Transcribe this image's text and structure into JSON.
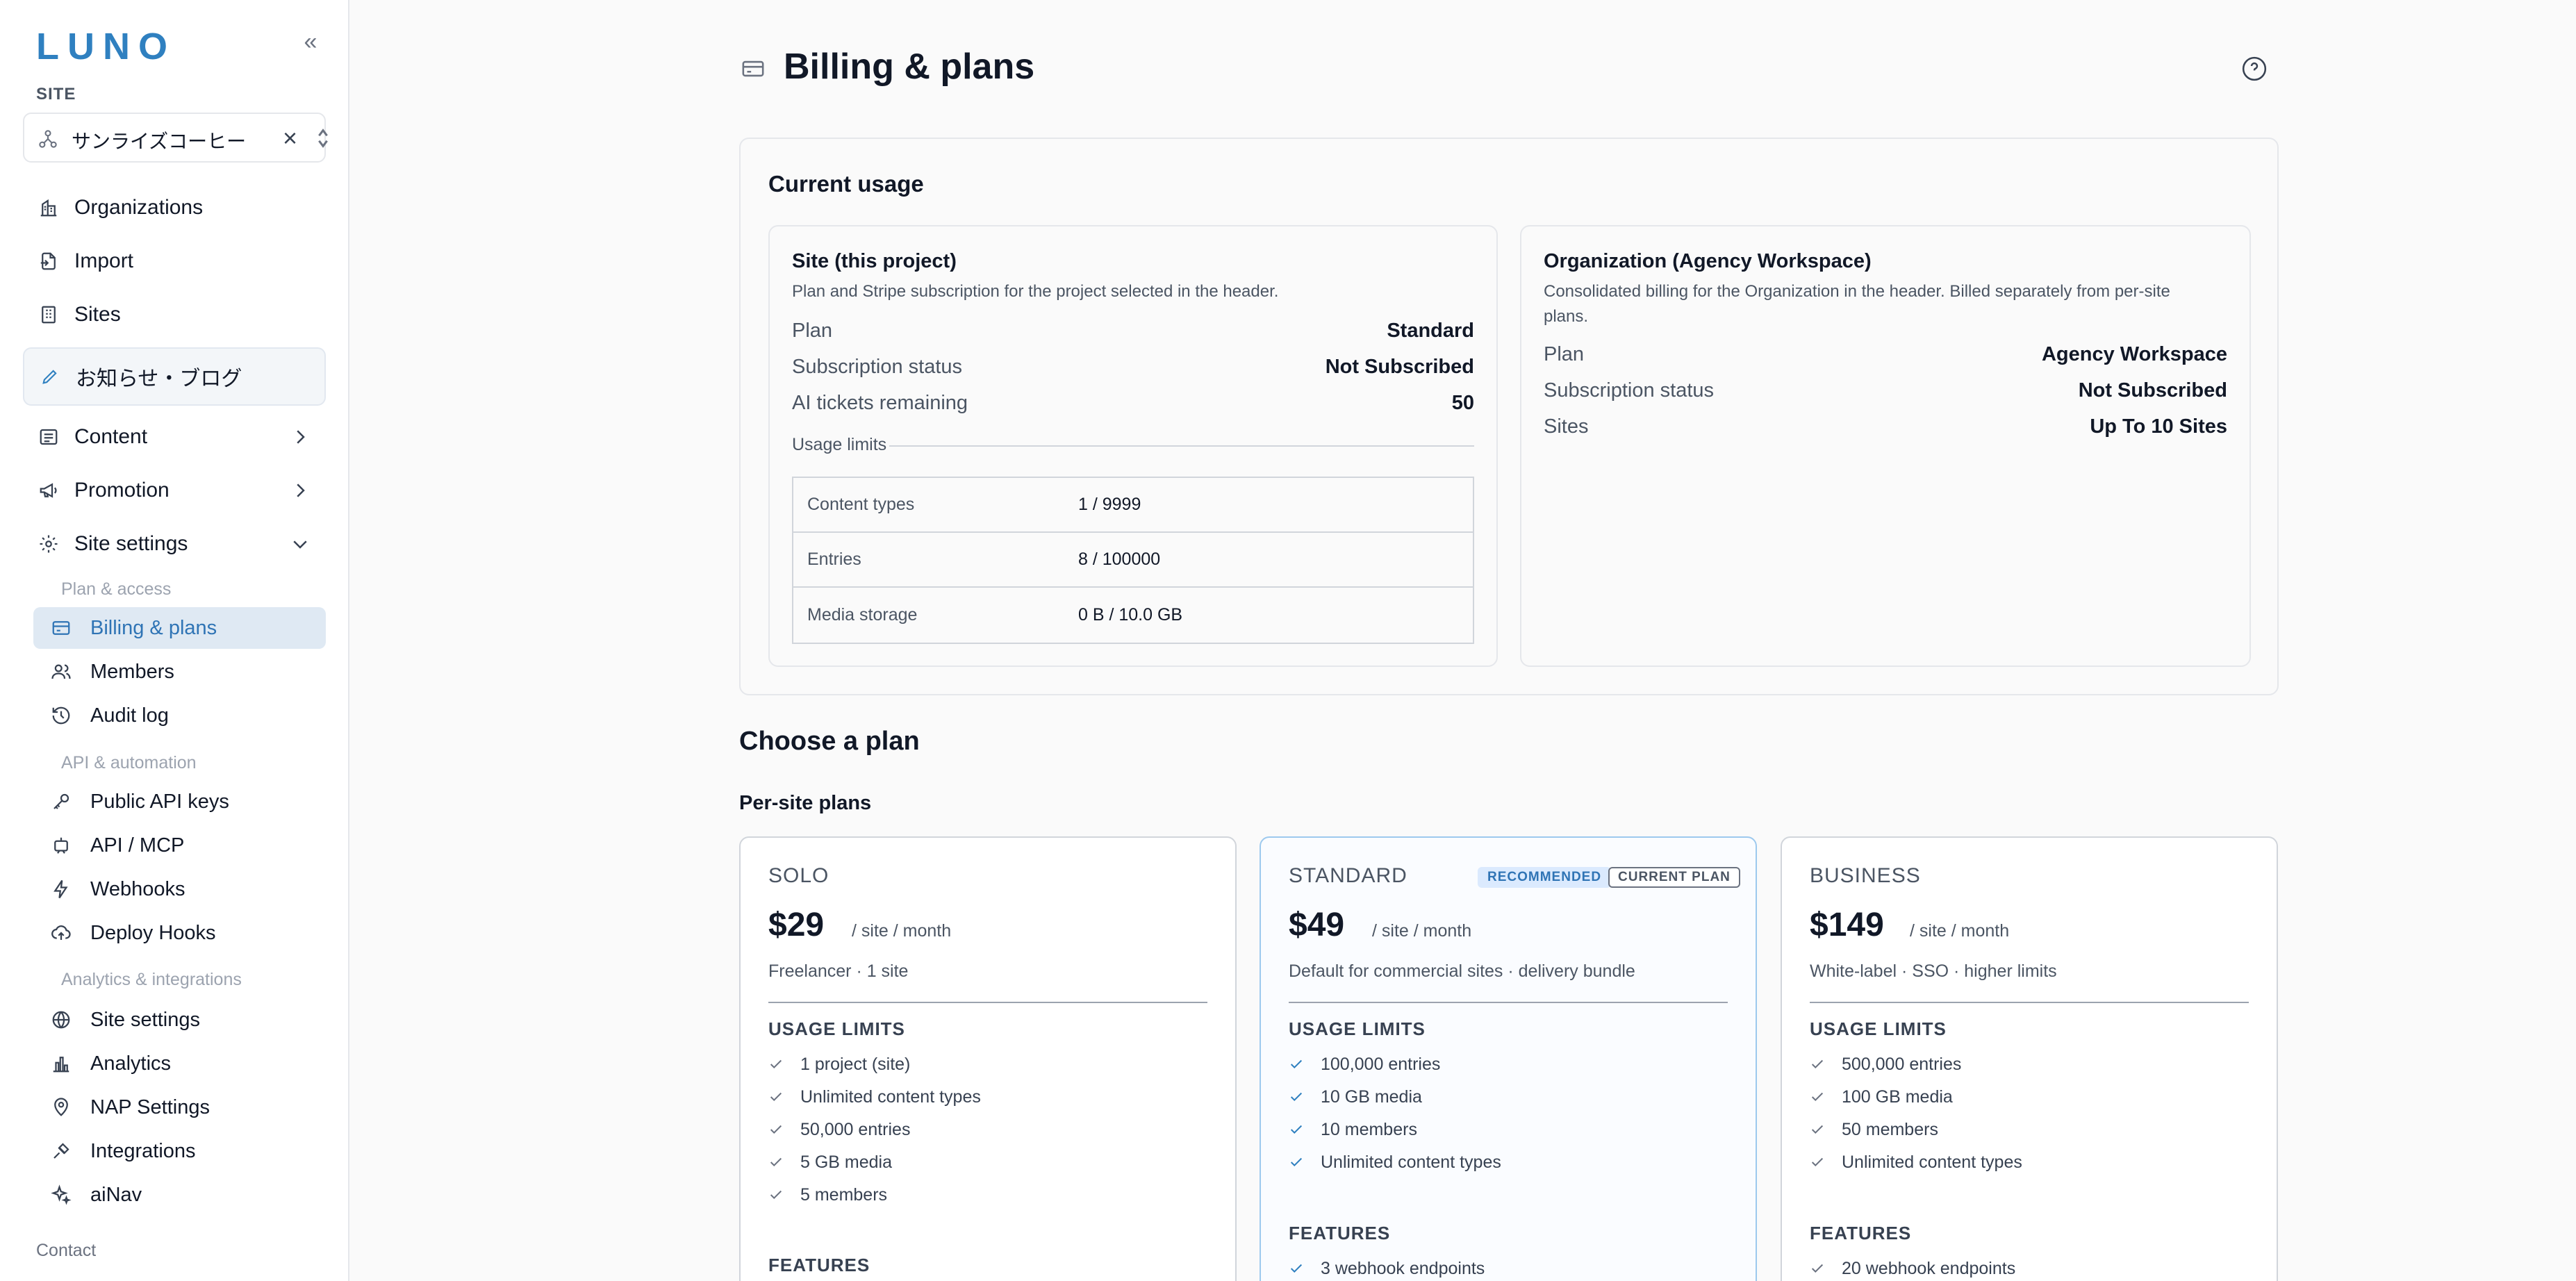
{
  "sidebar": {
    "logo": "LUNO",
    "site_label": "SITE",
    "site_value": "サンライズコーヒー",
    "items": [
      {
        "label": "Organizations"
      },
      {
        "label": "Import"
      },
      {
        "label": "Sites"
      },
      {
        "label": "お知らせ・ブログ"
      },
      {
        "label": "Content"
      },
      {
        "label": "Promotion"
      },
      {
        "label": "Site settings"
      }
    ],
    "groups": {
      "plan_access": "Plan & access",
      "api_automation": "API & automation",
      "analytics_integrations": "Analytics & integrations"
    },
    "sub_items": [
      {
        "label": "Billing & plans"
      },
      {
        "label": "Members"
      },
      {
        "label": "Audit log"
      },
      {
        "label": "Public API keys"
      },
      {
        "label": "API / MCP"
      },
      {
        "label": "Webhooks"
      },
      {
        "label": "Deploy Hooks"
      },
      {
        "label": "Site settings"
      },
      {
        "label": "Analytics"
      },
      {
        "label": "NAP Settings"
      },
      {
        "label": "Integrations"
      },
      {
        "label": "aiNav"
      }
    ],
    "contact": "Contact"
  },
  "page": {
    "title": "Billing & plans"
  },
  "usage": {
    "title": "Current usage",
    "site": {
      "heading": "Site (this project)",
      "desc": "Plan and Stripe subscription for the project selected in the header.",
      "plan_k": "Plan",
      "plan_v": "Standard",
      "status_k": "Subscription status",
      "status_v": "Not Subscribed",
      "ai_k": "AI tickets remaining",
      "ai_v": "50",
      "limits_label": "Usage limits",
      "limits": [
        {
          "name": "Content types",
          "value": "1 / 9999"
        },
        {
          "name": "Entries",
          "value": "8 / 100000"
        },
        {
          "name": "Media storage",
          "value": "0 B / 10.0 GB"
        }
      ]
    },
    "org": {
      "heading": "Organization (Agency Workspace)",
      "desc1": "Consolidated billing for the Organization in the header. Billed separately from per-site",
      "desc2": "plans.",
      "plan_k": "Plan",
      "plan_v": "Agency Workspace",
      "status_k": "Subscription status",
      "status_v": "Not Subscribed",
      "sites_k": "Sites",
      "sites_v": "Up To 10 Sites"
    }
  },
  "plans": {
    "title": "Choose a plan",
    "subtitle": "Per-site plans",
    "usage_limits_label": "USAGE LIMITS",
    "features_label": "FEATURES",
    "solo": {
      "name": "SOLO",
      "price": "$29",
      "per": "/ site / month",
      "tag": "Freelancer · 1 site",
      "limits": [
        "1 project (site)",
        "Unlimited content types",
        "50,000 entries",
        "5 GB media",
        "5 members"
      ]
    },
    "standard": {
      "name": "STANDARD",
      "badge_rec": "RECOMMENDED",
      "badge_cur": "CURRENT PLAN",
      "price": "$49",
      "per": "/ site / month",
      "tag": "Default for commercial sites · delivery bundle",
      "limits": [
        "100,000 entries",
        "10 GB media",
        "10 members",
        "Unlimited content types"
      ],
      "features": [
        "3 webhook endpoints"
      ]
    },
    "business": {
      "name": "BUSINESS",
      "price": "$149",
      "per": "/ site / month",
      "tag": "White-label · SSO · higher limits",
      "limits": [
        "500,000 entries",
        "100 GB media",
        "50 members",
        "Unlimited content types"
      ],
      "features": [
        "20 webhook endpoints"
      ]
    }
  },
  "colors": {
    "accent": "#2f80c0",
    "active_bg": "#dfe9f3",
    "check": "#6b7280"
  }
}
